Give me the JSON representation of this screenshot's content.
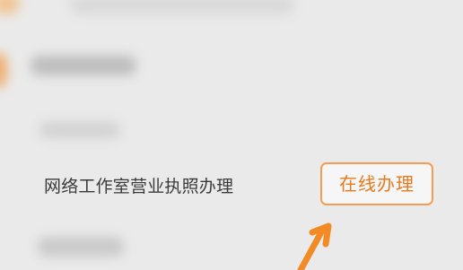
{
  "service": {
    "title": "网络工作室营业执照办理",
    "action_label": "在线办理"
  },
  "colors": {
    "accent": "#f28a26",
    "button_text": "#e57a1f",
    "button_border": "#f59b52",
    "background": "#eaeaea"
  },
  "icons": {
    "pointer": "arrow-up-right-icon"
  }
}
